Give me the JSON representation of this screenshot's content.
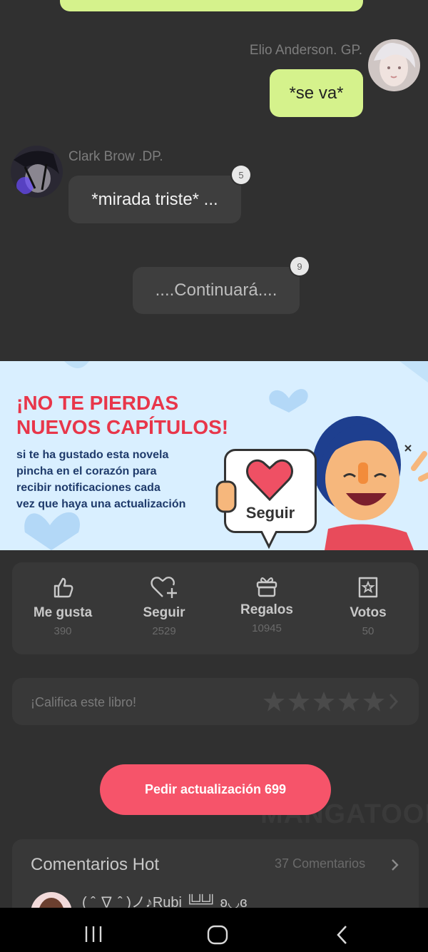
{
  "messages": [
    {
      "name": "Elio Anderson. GP.",
      "text": "*se va*"
    },
    {
      "name": "Clark  Brow .DP.",
      "text": "*mirada triste* ...",
      "badge": "5"
    },
    {
      "text": "....Continuará....",
      "badge": "9"
    }
  ],
  "banner": {
    "title_line1": "¡NO TE PIERDAS",
    "title_line2": "NUEVOS CAPÍTULOS!",
    "body_lines": [
      "si te ha gustado esta novela",
      "pincha en el corazón para",
      "recibir notificaciones cada",
      "vez que haya una actualización"
    ],
    "sign_label": "Seguir"
  },
  "stats": [
    {
      "label": "Me gusta",
      "count": "390",
      "icon": "thumbs-up-icon"
    },
    {
      "label": "Seguir",
      "count": "2529",
      "icon": "heart-plus-icon"
    },
    {
      "label": "Regalos",
      "count": "10945",
      "icon": "gift-icon"
    },
    {
      "label": "Votos",
      "count": "50",
      "icon": "vote-ticket-icon"
    }
  ],
  "rating": {
    "prompt": "¡Califica este libro!",
    "stars": 5
  },
  "update_button": "Pedir actualización 699",
  "watermark": "MANGATOON",
  "comments": {
    "title": "Comentarios Hot",
    "count_label": "37 Comentarios",
    "first_user": "( ˆ ∇ ˆ )ノ♪Rubi ╚╩╝ ʚ◡ɞ"
  },
  "colors": {
    "accent": "#f6546a",
    "user_bubble": "#d5f28c",
    "banner_title": "#e8364a",
    "background": "#303030"
  }
}
